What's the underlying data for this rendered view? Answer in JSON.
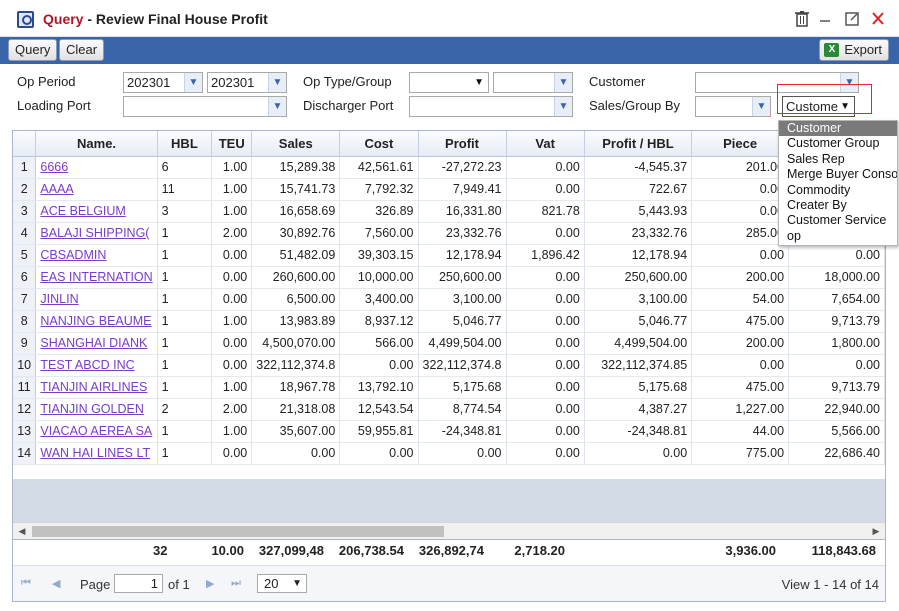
{
  "window": {
    "title_query": "Query",
    "title_rest": " - Review Final House Profit",
    "icons": [
      "query-icon",
      "trash-icon",
      "minimize-icon",
      "maximize-icon",
      "close-icon"
    ]
  },
  "toolbar": {
    "query_label": "Query",
    "clear_label": "Clear",
    "export_label": "Export"
  },
  "filters": {
    "op_period_label": "Op Period",
    "op_period_from": "202301",
    "op_period_to": "202301",
    "op_type_label": "Op Type/Group",
    "op_type_value": "",
    "op_group_value": "",
    "customer_label": "Customer",
    "customer_value": "",
    "loading_port_label": "Loading Port",
    "loading_port_value": "",
    "discharger_port_label": "Discharger Port",
    "discharger_port_value": "",
    "sales_group_label": "Sales/Group By",
    "sales_value": "",
    "group_by_value": "Custome"
  },
  "group_by_options": [
    "Customer",
    "Customer Group",
    "Sales Rep",
    "Merge Buyer Consol",
    "Commodity",
    "Creater By",
    "Customer Service",
    "op"
  ],
  "grid": {
    "columns": [
      "Name.",
      "HBL",
      "TEU",
      "Sales",
      "Cost",
      "Profit",
      "Vat",
      "Profit / HBL",
      "Piece",
      ""
    ],
    "rows": [
      {
        "n": "1",
        "name": "6666",
        "hbl": "6",
        "teu": "1.00",
        "sales": "15,289.38",
        "cost": "42,561.61",
        "profit": "-27,272.23",
        "vat": "0.00",
        "phbl": "-4,545.37",
        "piece": "201.00",
        "last": ""
      },
      {
        "n": "2",
        "name": "AAAA",
        "hbl": "11",
        "teu": "1.00",
        "sales": "15,741.73",
        "cost": "7,792.32",
        "profit": "7,949.41",
        "vat": "0.00",
        "phbl": "722.67",
        "piece": "0.00",
        "last": ""
      },
      {
        "n": "3",
        "name": "ACE BELGIUM",
        "hbl": "3",
        "teu": "1.00",
        "sales": "16,658.69",
        "cost": "326.89",
        "profit": "16,331.80",
        "vat": "821.78",
        "phbl": "5,443.93",
        "piece": "0.00",
        "last": ""
      },
      {
        "n": "4",
        "name": "BALAJI SHIPPING(",
        "hbl": "1",
        "teu": "2.00",
        "sales": "30,892.76",
        "cost": "7,560.00",
        "profit": "23,332.76",
        "vat": "0.00",
        "phbl": "23,332.76",
        "piece": "285.00",
        "last": ""
      },
      {
        "n": "5",
        "name": "CBSADMIN",
        "hbl": "1",
        "teu": "0.00",
        "sales": "51,482.09",
        "cost": "39,303.15",
        "profit": "12,178.94",
        "vat": "1,896.42",
        "phbl": "12,178.94",
        "piece": "0.00",
        "last": "0.00"
      },
      {
        "n": "6",
        "name": "EAS INTERNATION",
        "hbl": "1",
        "teu": "0.00",
        "sales": "260,600.00",
        "cost": "10,000.00",
        "profit": "250,600.00",
        "vat": "0.00",
        "phbl": "250,600.00",
        "piece": "200.00",
        "last": "18,000.00"
      },
      {
        "n": "7",
        "name": "JINLIN",
        "hbl": "1",
        "teu": "0.00",
        "sales": "6,500.00",
        "cost": "3,400.00",
        "profit": "3,100.00",
        "vat": "0.00",
        "phbl": "3,100.00",
        "piece": "54.00",
        "last": "7,654.00"
      },
      {
        "n": "8",
        "name": "NANJING BEAUME",
        "hbl": "1",
        "teu": "1.00",
        "sales": "13,983.89",
        "cost": "8,937.12",
        "profit": "5,046.77",
        "vat": "0.00",
        "phbl": "5,046.77",
        "piece": "475.00",
        "last": "9,713.79"
      },
      {
        "n": "9",
        "name": "SHANGHAI DIANK",
        "hbl": "1",
        "teu": "0.00",
        "sales": "4,500,070.00",
        "cost": "566.00",
        "profit": "4,499,504.00",
        "vat": "0.00",
        "phbl": "4,499,504.00",
        "piece": "200.00",
        "last": "1,800.00"
      },
      {
        "n": "10",
        "name": "TEST ABCD INC",
        "hbl": "1",
        "teu": "0.00",
        "sales": "322,112,374.8",
        "cost": "0.00",
        "profit": "322,112,374.8",
        "vat": "0.00",
        "phbl": "322,112,374.85",
        "piece": "0.00",
        "last": "0.00"
      },
      {
        "n": "11",
        "name": "TIANJIN AIRLINES",
        "hbl": "1",
        "teu": "1.00",
        "sales": "18,967.78",
        "cost": "13,792.10",
        "profit": "5,175.68",
        "vat": "0.00",
        "phbl": "5,175.68",
        "piece": "475.00",
        "last": "9,713.79"
      },
      {
        "n": "12",
        "name": "TIANJIN GOLDEN",
        "hbl": "2",
        "teu": "2.00",
        "sales": "21,318.08",
        "cost": "12,543.54",
        "profit": "8,774.54",
        "vat": "0.00",
        "phbl": "4,387.27",
        "piece": "1,227.00",
        "last": "22,940.00"
      },
      {
        "n": "13",
        "name": "VIACAO AEREA SA",
        "hbl": "1",
        "teu": "1.00",
        "sales": "35,607.00",
        "cost": "59,955.81",
        "profit": "-24,348.81",
        "vat": "0.00",
        "phbl": "-24,348.81",
        "piece": "44.00",
        "last": "5,566.00"
      },
      {
        "n": "14",
        "name": "WAN HAI LINES LT",
        "hbl": "1",
        "teu": "0.00",
        "sales": "0.00",
        "cost": "0.00",
        "profit": "0.00",
        "vat": "0.00",
        "phbl": "0.00",
        "piece": "775.00",
        "last": "22,686.40"
      }
    ],
    "totals": {
      "hbl": "32",
      "teu": "10.00",
      "sales": "327,099,48",
      "cost": "206,738.54",
      "profit": "326,892,74",
      "vat": "2,718.20",
      "phbl": "",
      "piece": "3,936.00",
      "last": "118,843.68"
    }
  },
  "pager": {
    "page_label": "Page",
    "page_value": "1",
    "of_label": "of 1",
    "page_size": "20",
    "view_text": "View 1 - 14 of 14"
  }
}
